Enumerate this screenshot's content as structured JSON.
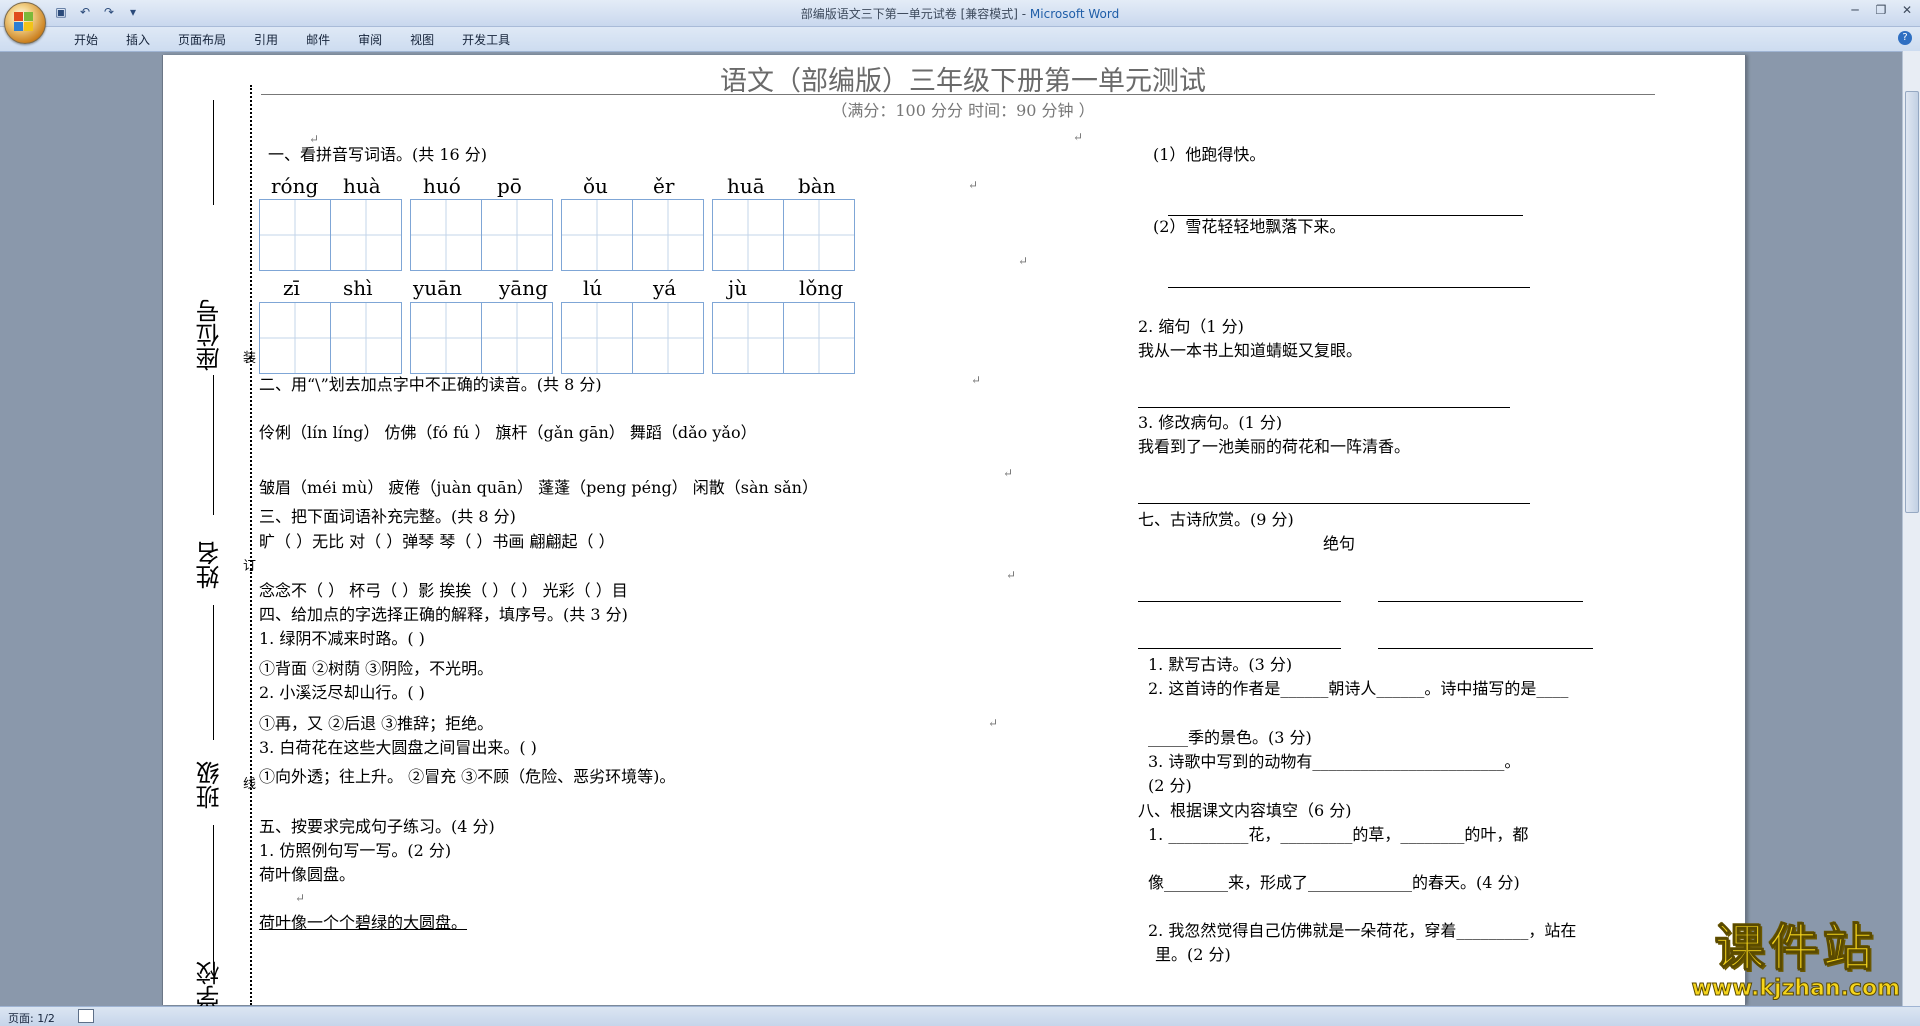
{
  "window": {
    "title_doc": "部编版语文三下第一单元试卷 [兼容模式] - ",
    "title_app": "Microsoft Word"
  },
  "menu": [
    "开始",
    "插入",
    "页面布局",
    "引用",
    "邮件",
    "审阅",
    "视图",
    "开发工具"
  ],
  "status": {
    "page": "页面: 1/2"
  },
  "doc": {
    "title": "语文（部编版）三年级下册第一单元测试",
    "subtitle": "（满分：100 分分      时间：90 分钟      ）",
    "rail": [
      "座位号",
      "姓名",
      "班级",
      "学校"
    ],
    "binding": [
      "装",
      "订",
      "线"
    ],
    "s1_title": "一、看拼音写词语。(共 16 分)",
    "pinyin_row1": [
      "róng",
      "huà",
      "huó",
      "pō",
      "ǒu",
      "ěr",
      "huā",
      "bàn"
    ],
    "pinyin_row2": [
      "zī",
      "shì",
      "yuān",
      "yāng",
      "lú",
      "yá",
      "jù",
      "lǒng"
    ],
    "s2_title": "二、用“\\”划去加点字中不正确的读音。(共 8 分)",
    "s2_line1": "伶俐（lín  líng）  仿佛（fó  fú ）  旗杆（gǎn  gān） 舞蹈（dǎo  yǎo）",
    "s2_line2": "皱眉（méi  mù）  疲倦（juàn  quān） 蓬蓬（peng  péng）  闲散（sàn  sǎn）",
    "s3_title": "三、把下面词语补充完整。(共 8 分)",
    "s3_line1": "旷（  ）无比  对（  ）弹琴   琴（  ）书画     翩翩起（  ）",
    "s3_line2": "念念不（  ）    杯弓（  ）影    挨挨（  ）（  ）    光彩（  ）目",
    "s4_title": "四、给加点的字选择正确的解释，填序号。(共 3 分)",
    "s4_q1": "1. 绿阴不减来时路。(    )",
    "s4_q1_opts": "①背面    ②树荫    ③阴险，不光明。",
    "s4_q2": "2. 小溪泛尽却山行。(    )",
    "s4_q2_opts": "①再，又  ②后退    ③推辞；拒绝。",
    "s4_q3": "3. 白荷花在这些大圆盘之间冒出来。(    )",
    "s4_q3_opts": "①向外透；往上升。     ②冒充     ③不顾（危险、恶劣环境等)。",
    "s5_title": "五、按要求完成句子练习。(4 分)",
    "s5_q1": "1. 仿照例句写一写。(2 分)",
    "s5_ex1": "荷叶像圆盘。",
    "s5_ex2": "荷叶像一个个碧绿的大圆盘。",
    "r_q1": "(1）他跑得快。",
    "r_q2": "(2）雪花轻轻地飘落下来。",
    "r_s2": "2. 缩句（1 分)",
    "r_s2_text": "我从一本书上知道蜻蜓又复眼。",
    "r_s3": "3. 修改病句。(1 分)",
    "r_s3_text": "我看到了一池美丽的荷花和一阵清香。",
    "s7_title": "七、古诗欣赏。(9 分)",
    "s7_poem": "绝句",
    "s7_q1": "1. 默写古诗。(3 分)",
    "s7_q2a": "2. 这首诗的作者是______朝诗人______。诗中描写的是____",
    "s7_q2b": "_____季的景色。(3 分)",
    "s7_q3a": "3. 诗歌中写到的动物有________________________。",
    "s7_q3b": "(2 分)",
    "s8_title": "八、根据课文内容填空（6 分)",
    "s8_q1a": "1. __________花，_________的草，________的叶，都",
    "s8_q1b": "像________来，形成了_____________的春天。(4 分)",
    "s8_q2a": "2. 我忽然觉得自己仿佛就是一朵荷花，穿着_________，站在",
    "s8_q2b": "里。(2 分)"
  },
  "watermark": {
    "cn": "课件站",
    "en": "www.kjzhan.com"
  }
}
